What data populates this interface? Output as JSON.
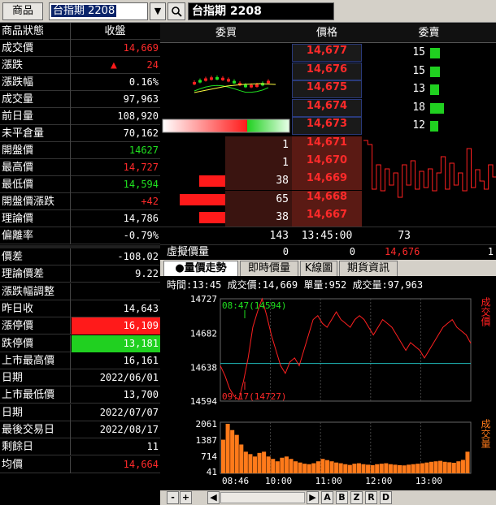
{
  "toolbar": {
    "product_label": "商品",
    "symbol_value": "台指期 2208",
    "dropdown_glyph": "▼",
    "search_glyph": "🔍",
    "title": "台指期 2208"
  },
  "quote": {
    "header": {
      "label": "商品狀態",
      "value": "收盤"
    },
    "rows": [
      {
        "label": "成交價",
        "value": "14,669",
        "color": "#ff2a2a"
      },
      {
        "label": "漲跌",
        "value": "24",
        "arrow": "▲",
        "color": "#ff2a2a"
      },
      {
        "label": "漲跌幅",
        "value": "0.16%",
        "color": "#ffffff"
      },
      {
        "label": "成交量",
        "value": "97,963",
        "color": "#ffffff"
      },
      {
        "label": "前日量",
        "value": "108,920",
        "color": "#ffffff"
      },
      {
        "label": "未平倉量",
        "value": "70,162",
        "color": "#ffffff"
      },
      {
        "label": "開盤價",
        "value": "14627",
        "color": "#20e020"
      },
      {
        "label": "最高價",
        "value": "14,727",
        "color": "#ff2a2a"
      },
      {
        "label": "最低價",
        "value": "14,594",
        "color": "#20e020"
      },
      {
        "label": "開盤價漲跌",
        "value": "+42",
        "color": "#ff2a2a"
      },
      {
        "label": "理論價",
        "value": "14,786",
        "color": "#ffffff"
      },
      {
        "label": "偏離率",
        "value": "-0.79%",
        "color": "#ffffff"
      }
    ],
    "rows2": [
      {
        "label": "價差",
        "value": "-108.02",
        "color": "#ffffff"
      },
      {
        "label": "理論價差",
        "value": "9.22",
        "color": "#ffffff"
      },
      {
        "label": "漲跌幅調整",
        "value": "",
        "color": "#ffffff"
      },
      {
        "label": "昨日收",
        "value": "14,643",
        "color": "#ffffff"
      },
      {
        "label": "漲停價",
        "value": "16,109",
        "color": "#ffffff",
        "bg": "#ff1a1a"
      },
      {
        "label": "跌停價",
        "value": "13,181",
        "color": "#ffffff",
        "bg": "#20d020"
      },
      {
        "label": "上市最高價",
        "value": "16,161",
        "color": "#ffffff"
      },
      {
        "label": "日期",
        "value": "2022/06/01",
        "color": "#ffffff"
      },
      {
        "label": "上市最低價",
        "value": "13,700",
        "color": "#ffffff"
      },
      {
        "label": "日期",
        "value": "2022/07/07",
        "color": "#ffffff"
      },
      {
        "label": "最後交易日",
        "value": "2022/08/17",
        "color": "#ffffff"
      },
      {
        "label": "剩餘日",
        "value": "11",
        "color": "#ffffff"
      },
      {
        "label": "均價",
        "value": "14,664",
        "color": "#ff2a2a"
      }
    ]
  },
  "book": {
    "headers": {
      "bid": "委買",
      "price": "價格",
      "ask": "委賣"
    },
    "asks": [
      {
        "price": "14,677",
        "qty": "15",
        "bar": 0.4
      },
      {
        "price": "14,676",
        "qty": "15",
        "bar": 0.4
      },
      {
        "price": "14,675",
        "qty": "13",
        "bar": 0.35
      },
      {
        "price": "14,674",
        "qty": "18",
        "bar": 0.55
      },
      {
        "price": "14,673",
        "qty": "12",
        "bar": 0.32
      }
    ],
    "bids": [
      {
        "price": "14,671",
        "qty": "1",
        "bar": 0.0
      },
      {
        "price": "14,670",
        "qty": "1",
        "bar": 0.0
      },
      {
        "price": "14,669",
        "qty": "38",
        "bar": 0.58
      },
      {
        "price": "14,668",
        "qty": "65",
        "bar": 1.0
      },
      {
        "price": "14,667",
        "qty": "38",
        "bar": 0.58
      }
    ],
    "totals": {
      "bid": "143",
      "time": "13:45:00",
      "ask": "73"
    },
    "sim": {
      "label": "虛擬價量",
      "bid": "0",
      "mid": "0",
      "price": "14,676",
      "ask": "1"
    }
  },
  "tabs": [
    {
      "label": "●量價走勢",
      "active": true
    },
    {
      "label": "即時價量",
      "active": false
    },
    {
      "label": "K線圖",
      "active": false
    },
    {
      "label": "期貨資訊",
      "active": false
    }
  ],
  "chart_info": "時間:13:45 成交價:14,669 單量:952 成交量:97,963",
  "chart_data": {
    "type": "line",
    "price_axis": [
      "14727",
      "14682",
      "14638",
      "14594"
    ],
    "volume_axis": [
      "2061",
      "1387",
      "714",
      "41"
    ],
    "time_axis": [
      "08:46",
      "10:00",
      "11:00",
      "12:00",
      "13:00"
    ],
    "ylim": [
      14594,
      14727
    ],
    "reference_price": 14643,
    "annotations": [
      {
        "text": "08:47(14594)",
        "color": "#20e020"
      },
      {
        "text": "09:17(14727)",
        "color": "#ff2a2a"
      }
    ],
    "side_labels": {
      "price": "成交價",
      "volume": "成交量"
    },
    "colors": {
      "price": "#ff2020",
      "volume": "#ff7a1a",
      "ref": "#20c0c0"
    },
    "price_series": [
      14640,
      14627,
      14610,
      14600,
      14596,
      14620,
      14650,
      14690,
      14710,
      14727,
      14705,
      14680,
      14660,
      14640,
      14630,
      14645,
      14650,
      14640,
      14660,
      14680,
      14700,
      14705,
      14695,
      14690,
      14700,
      14710,
      14700,
      14695,
      14690,
      14700,
      14705,
      14700,
      14690,
      14680,
      14690,
      14700,
      14695,
      14690,
      14680,
      14670,
      14660,
      14670,
      14665,
      14660,
      14650,
      14660,
      14670,
      14680,
      14690,
      14695,
      14700,
      14690,
      14685,
      14680,
      14669
    ],
    "volume_series": [
      1400,
      2061,
      1800,
      1600,
      1200,
      900,
      800,
      700,
      850,
      900,
      700,
      600,
      500,
      650,
      700,
      600,
      500,
      450,
      400,
      380,
      420,
      500,
      600,
      550,
      500,
      450,
      420,
      380,
      350,
      400,
      420,
      380,
      360,
      340,
      380,
      400,
      420,
      380,
      360,
      340,
      330,
      360,
      380,
      400,
      420,
      450,
      480,
      500,
      520,
      480,
      460,
      440,
      500,
      560,
      900
    ]
  },
  "nav": [
    "-",
    "+",
    "◀",
    "▶",
    "A",
    "B",
    "Z",
    "R",
    "D"
  ]
}
